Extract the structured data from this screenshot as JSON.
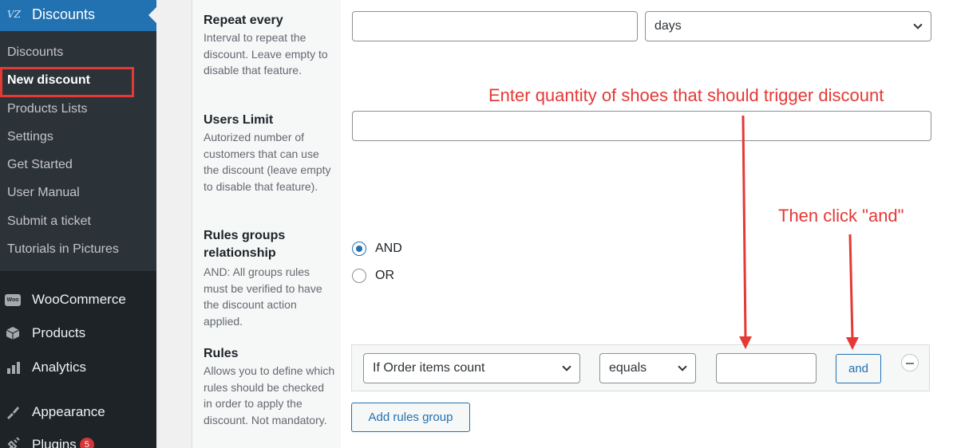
{
  "sidebar": {
    "header_logo": "VZ",
    "header_label": "Discounts",
    "submenu": [
      {
        "label": "Discounts",
        "current": false
      },
      {
        "label": "New discount",
        "current": true
      },
      {
        "label": "Products Lists",
        "current": false
      },
      {
        "label": "Settings",
        "current": false
      },
      {
        "label": "Get Started",
        "current": false
      },
      {
        "label": "User Manual",
        "current": false
      },
      {
        "label": "Submit a ticket",
        "current": false
      },
      {
        "label": "Tutorials in Pictures",
        "current": false
      }
    ],
    "main_items": [
      {
        "label": "WooCommerce",
        "icon": "woocommerce-icon",
        "icon_text": "Woo"
      },
      {
        "label": "Products",
        "icon": "products-icon"
      },
      {
        "label": "Analytics",
        "icon": "analytics-icon"
      },
      {
        "label": "Appearance",
        "icon": "appearance-icon"
      },
      {
        "label": "Plugins",
        "icon": "plugins-icon",
        "badge": "5"
      }
    ]
  },
  "form": {
    "repeat": {
      "title": "Repeat every",
      "desc": "Interval to repeat the discount. Leave empty to disable that feature.",
      "value": "",
      "unit": "days"
    },
    "users_limit": {
      "title": "Users Limit",
      "desc": "Autorized number of customers that can use the discount (leave empty to disable that feature).",
      "value": ""
    },
    "relationship": {
      "title": "Rules groups relationship",
      "desc": "AND: All groups rules must be verified to have the discount action applied.",
      "options": [
        "AND",
        "OR"
      ],
      "selected": "AND"
    },
    "rules": {
      "title": "Rules",
      "desc": "Allows you to define which rules should be checked in order to apply the discount. Not mandatory.",
      "condition": "If Order items count",
      "operator": "equals",
      "value": "",
      "and_label": "and",
      "add_group_label": "Add rules group"
    }
  },
  "annotations": {
    "quantity_note": "Enter quantity of shoes that should trigger discount",
    "click_note": "Then click \"and\"",
    "color": "#e53935"
  }
}
